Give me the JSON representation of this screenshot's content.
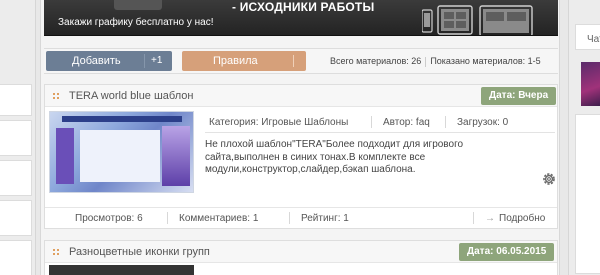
{
  "banner": {
    "headline": "- ИСХОДНИКИ РАБОТЫ",
    "promo": "Закажи графику бесплатно у нас!"
  },
  "toolbar": {
    "add_label": "Добавить",
    "add_count": "+1",
    "rules_label": "Правила",
    "total_label": "Всего материалов: 26",
    "shown_label": "Показано материалов: 1-5"
  },
  "sidebar_right": {
    "chat_label": "Чат"
  },
  "posts": [
    {
      "title": "TERA world blue шаблон",
      "date": "Дата: Вчера",
      "category": "Категория: Игровые Шаблоны",
      "author": "Автор: faq",
      "downloads": "Загрузок: 0",
      "description": "Не плохой шаблон\"TERA\"Более подходит для игрового сайта,выполнен в синих тонах.В комплекте все модули,конструктор,слайдер,бэкап шаблона.",
      "views": "Просмотров: 6",
      "comments": "Комментариев: 1",
      "rating": "Рейтинг: 1",
      "more": "Подробно"
    },
    {
      "title": "Разноцветные иконки групп",
      "date": "Дата: 06.05.2015"
    }
  ],
  "colors": {
    "add_button": "#6c7e95",
    "rules_button": "#d6a07a",
    "date_badge": "#8ea57b",
    "banner_bg": "#2b2b2b"
  }
}
